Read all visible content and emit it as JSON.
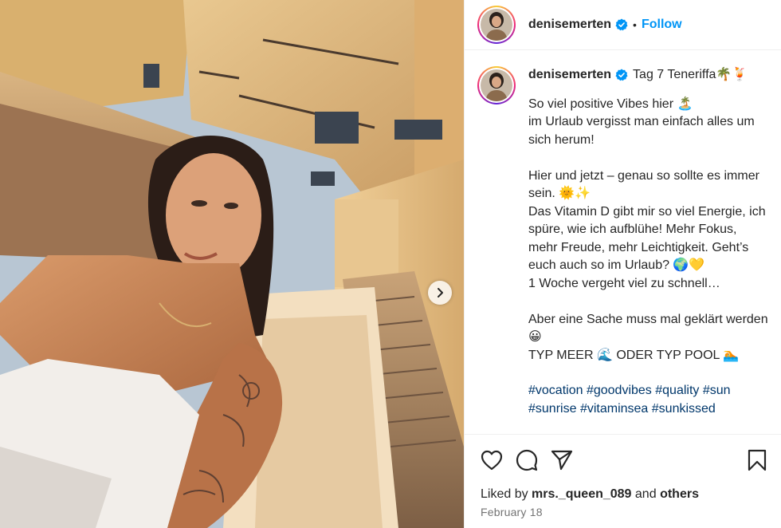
{
  "post": {
    "username": "denisemerten",
    "follow_label": "Follow",
    "separator": "•",
    "caption_title": "Tag 7 Teneriffa🌴🍹",
    "caption_text": "So viel positive Vibes hier 🏝️\nim Urlaub vergisst man einfach alles um sich herum!\n\nHier und jetzt – genau so sollte es immer sein. 🌞✨\nDas Vitamin D gibt mir so viel Energie, ich spüre, wie ich aufblühe! Mehr Fokus, mehr Freude, mehr Leichtigkeit. Geht’s euch auch so im Urlaub? 🌍💛\n1 Woche vergeht viel zu schnell…\n\nAber eine Sache muss mal geklärt werden 😀\nTYP MEER 🌊 ODER TYP POOL 🏊",
    "hashtags": [
      "#vocation",
      "#goodvibes",
      "#quality",
      "#sun",
      "#sunrise",
      "#vitaminsea",
      "#sunkissed"
    ],
    "likes_prefix": "Liked by",
    "liked_by_user": "mrs._queen_089",
    "likes_and": "and",
    "likes_others": "others",
    "date": "February 18"
  },
  "icons": {
    "verified": "verified-badge-icon",
    "like": "heart-icon",
    "comment": "comment-bubble-icon",
    "share": "paper-plane-icon",
    "save": "bookmark-icon",
    "next": "chevron-right-icon"
  },
  "colors": {
    "accent": "#0095f6",
    "hashtag": "#00376b",
    "text": "#262626",
    "muted": "#737373"
  }
}
